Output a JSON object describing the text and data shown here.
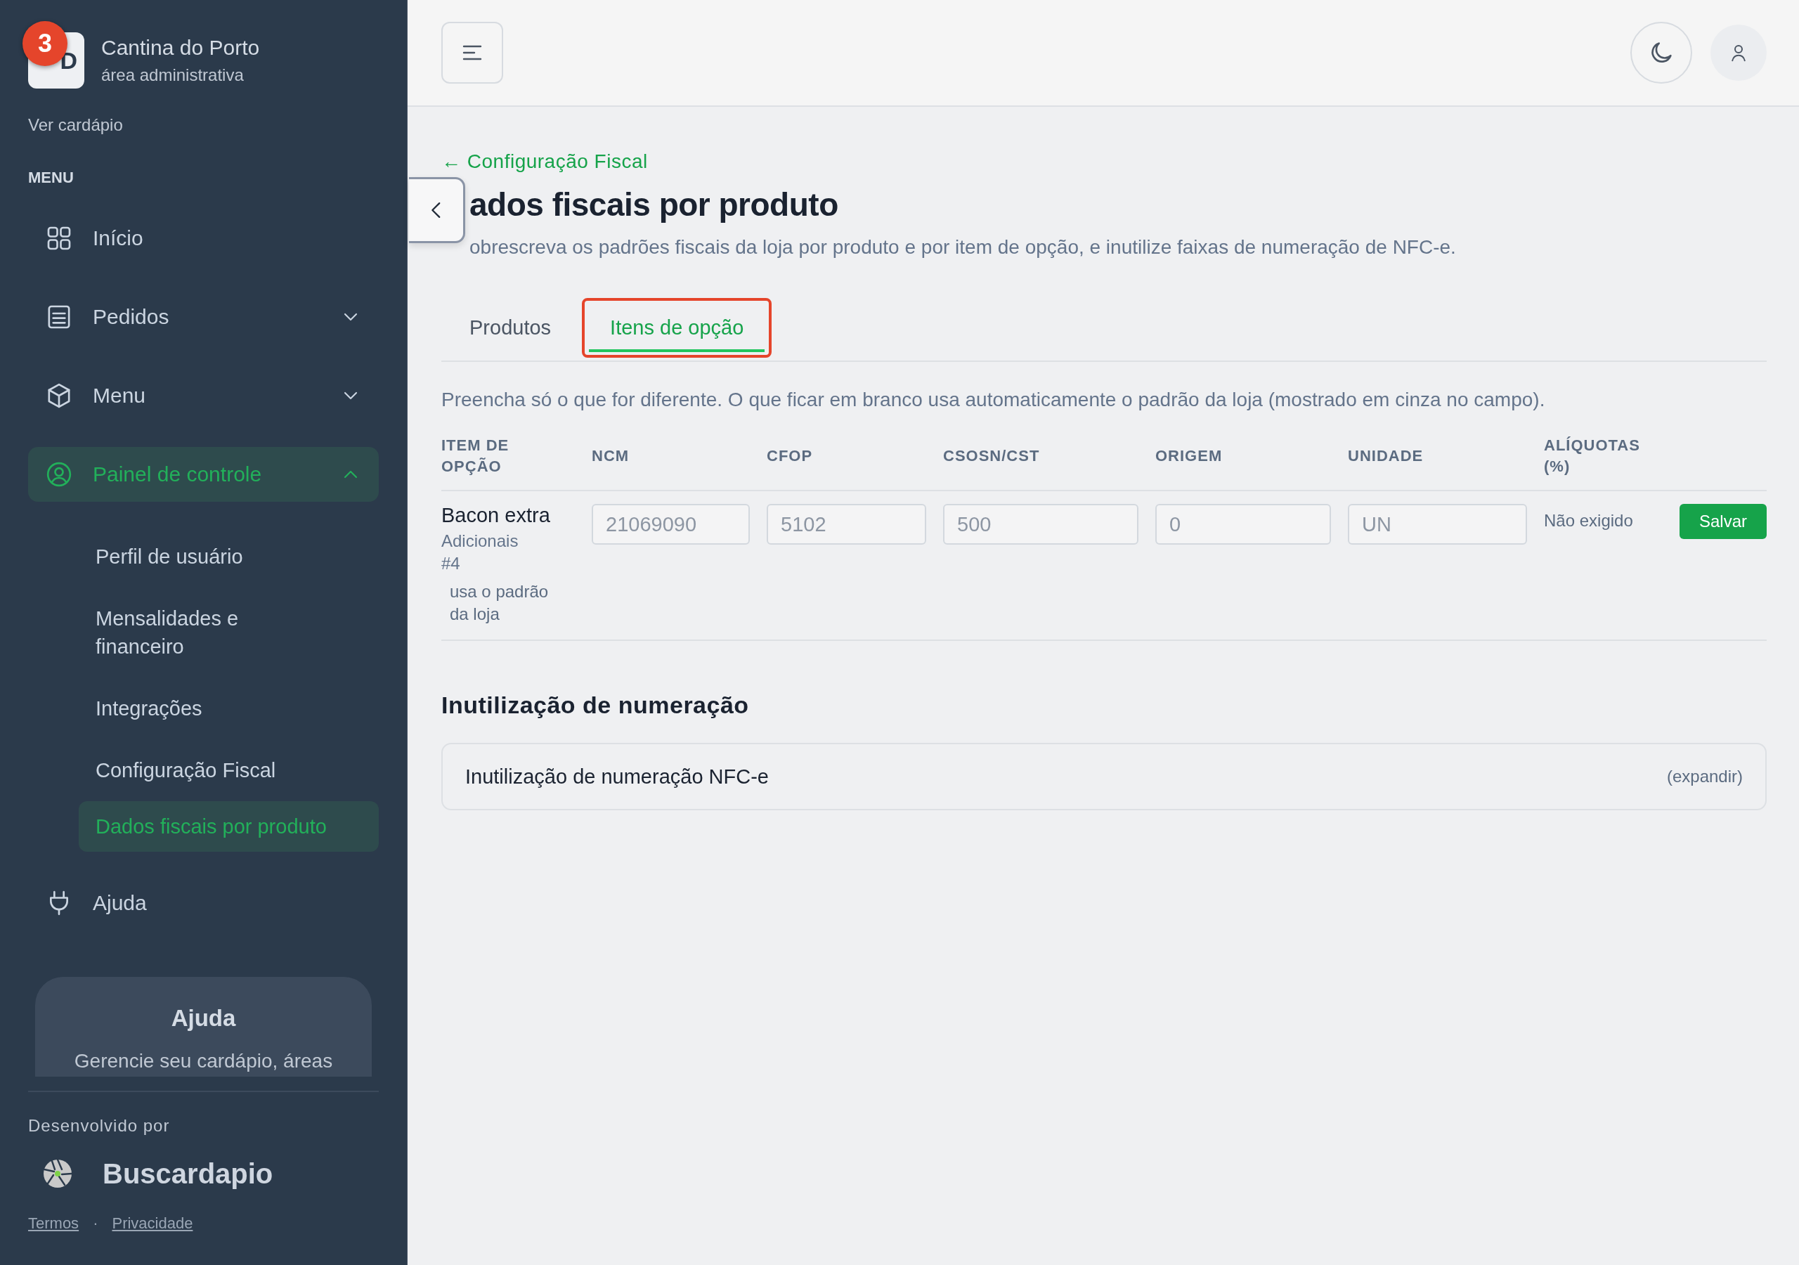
{
  "annotation": {
    "badge": "3"
  },
  "sidebar": {
    "logo_text": "D",
    "store_name": "Cantina do Porto",
    "store_subtitle": "área administrativa",
    "menu_link": "Ver cardápio",
    "section_label": "MENU",
    "items": [
      {
        "label": "Início",
        "kind": "link",
        "selected": false
      },
      {
        "label": "Pedidos",
        "kind": "group",
        "expanded": false,
        "selected": false
      },
      {
        "label": "Menu",
        "kind": "group",
        "expanded": false,
        "selected": false
      },
      {
        "label": "Painel de controle",
        "kind": "group",
        "expanded": true,
        "selected": true,
        "children": [
          {
            "label": "Perfil de usuário",
            "selected": false
          },
          {
            "label": "Mensalidades e financeiro",
            "selected": false
          },
          {
            "label": "Integrações",
            "selected": false
          },
          {
            "label": "Configuração Fiscal",
            "selected": false
          },
          {
            "label": "Dados fiscais por produto",
            "selected": true
          }
        ]
      },
      {
        "label": "Ajuda",
        "kind": "link",
        "selected": false
      }
    ],
    "help_card": {
      "title": "Ajuda",
      "text": "Gerencie seu cardápio, áreas"
    },
    "footer": {
      "credit": "Desenvolvido por",
      "brand": "Buscardapio",
      "links": [
        "Termos",
        "Privacidade"
      ],
      "separator": "·"
    }
  },
  "main": {
    "back_link": "← Configuração Fiscal",
    "title": "ados fiscais por produto",
    "subtitle": "obrescreva os padrões fiscais da loja por produto e por item de opção, e inutilize faixas de numeração de NFC-e.",
    "tabs": [
      {
        "label": "Produtos",
        "selected": false,
        "highlighted": false
      },
      {
        "label": "Itens de opção",
        "selected": true,
        "highlighted": true
      }
    ],
    "hint": "Preencha só o que for diferente. O que ficar em branco usa automaticamente o padrão da loja (mostrado em cinza no campo).",
    "table": {
      "columns": [
        "ITEM DE OPÇÃO",
        "NCM",
        "CFOP",
        "CSOSN/CST",
        "ORIGEM",
        "UNIDADE",
        "ALÍQUOTAS (%)"
      ],
      "rows": [
        {
          "name": "Bacon extra",
          "group": "Adicionais #4",
          "note": "usa o padrão da loja",
          "fields": [
            {
              "placeholder": "21069090"
            },
            {
              "placeholder": "5102"
            },
            {
              "placeholder": "500"
            },
            {
              "placeholder": "0"
            },
            {
              "placeholder": "UN"
            }
          ],
          "rates": "Não exigido",
          "action": "Salvar"
        }
      ]
    },
    "section_title": "Inutilização de numeração",
    "collapsible": {
      "label": "Inutilização de numeração NFC-e",
      "toggle": "(expandir)",
      "expanded": false
    }
  }
}
